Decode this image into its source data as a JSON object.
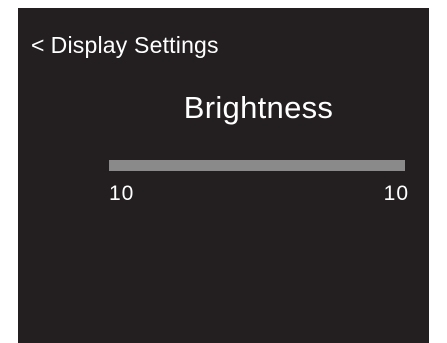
{
  "header": {
    "back_chevron": "<",
    "back_label": "Display Settings"
  },
  "main": {
    "title": "Brightness",
    "slider": {
      "level_fraction": 1.0,
      "left_value": "10",
      "right_value": "10"
    }
  },
  "colors": {
    "background": "#231f20",
    "text": "#ffffff",
    "track": "#6e6e6e"
  }
}
